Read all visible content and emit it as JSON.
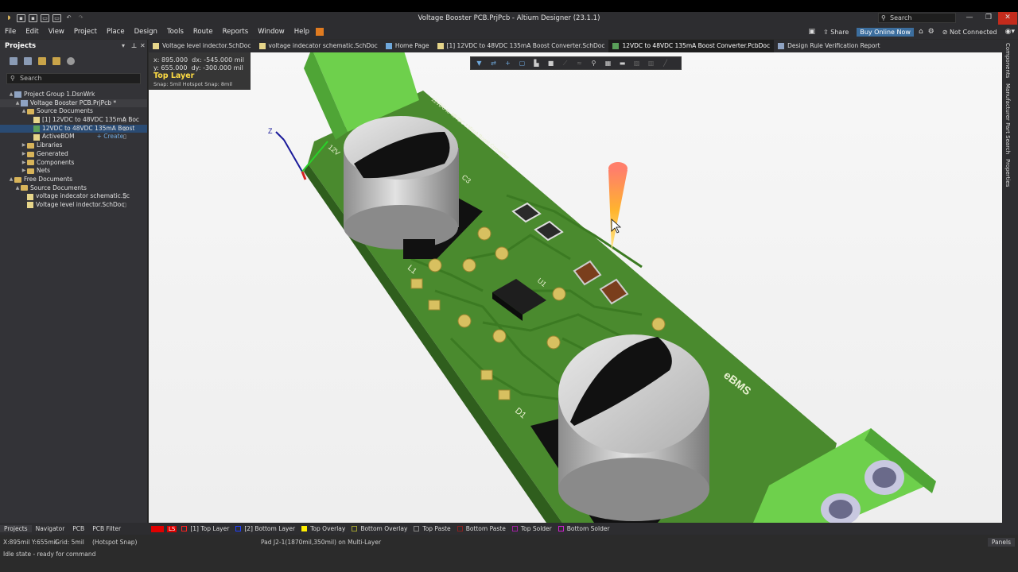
{
  "window": {
    "title": "Voltage Booster PCB.PrjPcb - Altium Designer (23.1.1)",
    "search_placeholder": "Search"
  },
  "menu": {
    "items": [
      "File",
      "Edit",
      "View",
      "Project",
      "Place",
      "Design",
      "Tools",
      "Route",
      "Reports",
      "Window",
      "Help"
    ],
    "share": "Share",
    "buy": "Buy Online Now",
    "not_connected": "Not Connected"
  },
  "projects_panel": {
    "title": "Projects",
    "search_placeholder": "Search",
    "tree": [
      {
        "label": "Project Group 1.DsnWrk",
        "indent": 0,
        "arrow": "▲",
        "icon": "proj"
      },
      {
        "label": "Voltage Booster PCB.PrjPcb *",
        "indent": 1,
        "arrow": "▲",
        "icon": "proj",
        "hl": true
      },
      {
        "label": "Source Documents",
        "indent": 2,
        "arrow": "▲",
        "icon": "folder"
      },
      {
        "label": "[1] 12VDC to 48VDC 135mA Boc",
        "indent": 3,
        "arrow": "",
        "icon": "doc"
      },
      {
        "label": "12VDC to 48VDC 135mA Boost",
        "indent": 3,
        "arrow": "",
        "icon": "pcb",
        "sel": true
      },
      {
        "label": "ActiveBOM",
        "indent": 3,
        "arrow": "",
        "icon": "doc",
        "create": "+ Create"
      },
      {
        "label": "Libraries",
        "indent": 2,
        "arrow": "▶",
        "icon": "folder"
      },
      {
        "label": "Generated",
        "indent": 2,
        "arrow": "▶",
        "icon": "folder"
      },
      {
        "label": "Components",
        "indent": 2,
        "arrow": "▶",
        "icon": "folder"
      },
      {
        "label": "Nets",
        "indent": 2,
        "arrow": "▶",
        "icon": "folder"
      },
      {
        "label": "Free Documents",
        "indent": 0,
        "arrow": "▲",
        "icon": "folder"
      },
      {
        "label": "Source Documents",
        "indent": 1,
        "arrow": "▲",
        "icon": "folder"
      },
      {
        "label": "voltage indecator schematic.Sc",
        "indent": 2,
        "arrow": "",
        "icon": "doc"
      },
      {
        "label": "Voltage level indector.SchDoc",
        "indent": 2,
        "arrow": "",
        "icon": "doc"
      }
    ]
  },
  "doc_tabs": [
    {
      "label": "Voltage level indector.SchDoc",
      "active": false
    },
    {
      "label": "voltage indecator schematic.SchDoc",
      "active": false
    },
    {
      "label": "Home Page",
      "active": false
    },
    {
      "label": "[1] 12VDC to 48VDC 135mA Boost Converter.SchDoc",
      "active": false
    },
    {
      "label": "12VDC to 48VDC 135mA Boost Converter.PcbDoc",
      "active": true
    },
    {
      "label": "Design Rule Verification Report",
      "active": false
    }
  ],
  "headsup": {
    "x_label": "x:",
    "x": "895.000",
    "dx_label": "dx:",
    "dx": "-545.000 mil",
    "y_label": "y:",
    "y": "655.000",
    "dy_label": "dy:",
    "dy": "-300.000 mil",
    "layer": "Top Layer",
    "snap": "Snap: 5mil Hotspot Snap: 8mil"
  },
  "right_panels": [
    "Components",
    "Manufacturer Part Search",
    "Properties"
  ],
  "bottom_tabs": [
    "Projects",
    "Navigator",
    "PCB",
    "PCB Filter"
  ],
  "layers": {
    "ls": "LS",
    "items": [
      {
        "label": "[1] Top Layer",
        "color": "#ff2020"
      },
      {
        "label": "[2] Bottom Layer",
        "color": "#2040ff"
      },
      {
        "label": "Top Overlay",
        "color": "#ffee00"
      },
      {
        "label": "Bottom Overlay",
        "color": "#a0a030"
      },
      {
        "label": "Top Paste",
        "color": "#888888"
      },
      {
        "label": "Bottom Paste",
        "color": "#8a2020"
      },
      {
        "label": "Top Solder",
        "color": "#a020a0"
      },
      {
        "label": "Bottom Solder",
        "color": "#d020d0"
      }
    ]
  },
  "status": {
    "coords": "X:895mil Y:655mil",
    "grid": "Grid: 5mil",
    "snap": "(Hotspot Snap)",
    "pad": "Pad J2-1(1870mil,350mil) on Multi-Layer",
    "idle": "Idle state - ready for command",
    "panels": "Panels"
  },
  "pcb": {
    "silk_title": "12VDC to 48VDC 135mA Boost Converter",
    "designators": [
      "C3",
      "L1",
      "U1",
      "D1",
      "12V",
      "Z"
    ],
    "logo": "eBMS",
    "board_color": "#4a8a2e",
    "connector_color": "#7ee05c"
  }
}
